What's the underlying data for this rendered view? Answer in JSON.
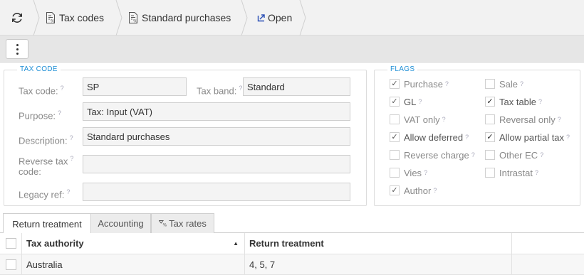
{
  "breadcrumbs": {
    "item1": "Tax codes",
    "item2": "Standard purchases",
    "action": "Open"
  },
  "tax_code_group": {
    "title": "TAX CODE",
    "tax_code_label": "Tax code:",
    "tax_code_value": "SP",
    "tax_band_label": "Tax band:",
    "tax_band_value": "Standard",
    "purpose_label": "Purpose:",
    "purpose_value": "Tax: Input (VAT)",
    "description_label": "Description:",
    "description_value": "Standard purchases",
    "reverse_tax_label_line1": "Reverse tax",
    "reverse_tax_label_line2": "code:",
    "reverse_tax_value": "",
    "legacy_ref_label": "Legacy ref:",
    "legacy_ref_value": "",
    "help_mark": "?"
  },
  "flags_group": {
    "title": "FLAGS",
    "items": [
      {
        "label": "Purchase",
        "checked": true
      },
      {
        "label": "Sale",
        "checked": false
      },
      {
        "label": "GL",
        "checked": true
      },
      {
        "label": "Tax table",
        "checked": true
      },
      {
        "label": "VAT only",
        "checked": false
      },
      {
        "label": "Reversal only",
        "checked": false
      },
      {
        "label": "Allow deferred",
        "checked": true
      },
      {
        "label": "Allow partial tax",
        "checked": true
      },
      {
        "label": "Reverse charge",
        "checked": false
      },
      {
        "label": "Other EC",
        "checked": false
      },
      {
        "label": "Vies",
        "checked": false
      },
      {
        "label": "Intrastat",
        "checked": false
      },
      {
        "label": "Author",
        "checked": true
      }
    ]
  },
  "tabs": [
    {
      "label": "Return treatment",
      "active": true
    },
    {
      "label": "Accounting",
      "active": false
    },
    {
      "label": "Tax rates",
      "active": false
    }
  ],
  "grid": {
    "columns": [
      "Tax authority",
      "Return treatment"
    ],
    "rows": [
      {
        "tax_authority": "Australia",
        "return_treatment": "4, 5, 7"
      }
    ]
  },
  "colors": {
    "accent": "#1f8fd6",
    "open_icon": "#2a4fb5"
  }
}
